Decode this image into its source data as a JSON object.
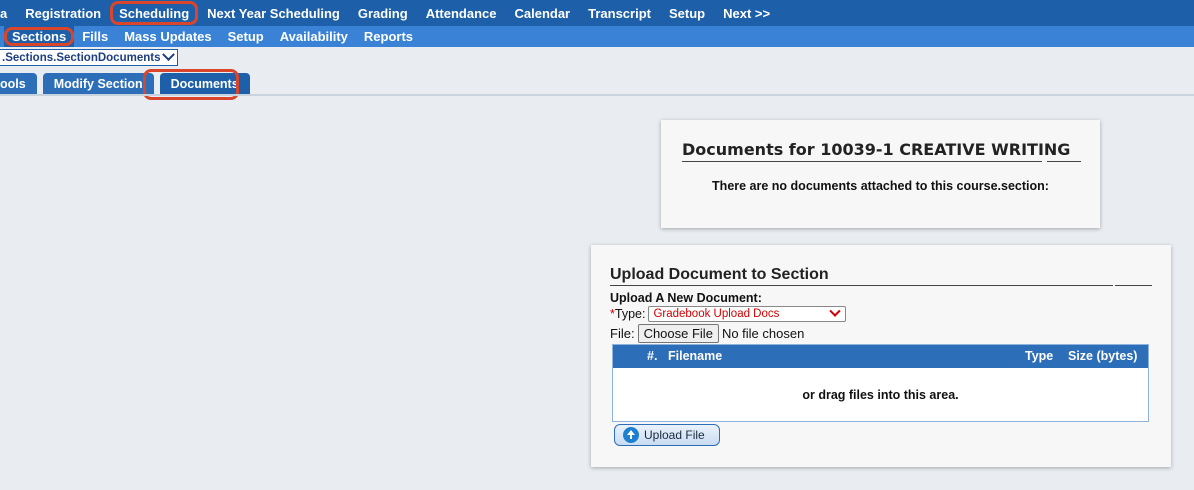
{
  "top_nav": {
    "items": [
      "a",
      "Registration",
      "Scheduling",
      "Next Year Scheduling",
      "Grading",
      "Attendance",
      "Calendar",
      "Transcript",
      "Setup",
      "Next >>"
    ]
  },
  "sub_nav": {
    "items": [
      "Sections",
      "Fills",
      "Mass Updates",
      "Setup",
      "Availability",
      "Reports"
    ]
  },
  "path_select": {
    "value": ".Sections.SectionDocuments"
  },
  "section_tabs": {
    "items": [
      "ools",
      "Modify Section",
      "Documents"
    ]
  },
  "documents_card": {
    "title": "Documents for 10039-1 CREATIVE WRITING",
    "message": "There are no documents attached to this course.section:"
  },
  "upload_card": {
    "title": "Upload Document to Section",
    "subtitle": "Upload A New Document:",
    "type_required_marker": "*",
    "type_label": "Type:",
    "type_value": "Gradebook Upload Docs",
    "file_label": "File:",
    "choose_file_label": "Choose File",
    "no_file_text": "No file chosen",
    "columns": [
      "#.",
      "Filename",
      "Type",
      "Size (bytes)"
    ],
    "drag_text": "or drag files into this area.",
    "upload_button": "Upload File"
  }
}
